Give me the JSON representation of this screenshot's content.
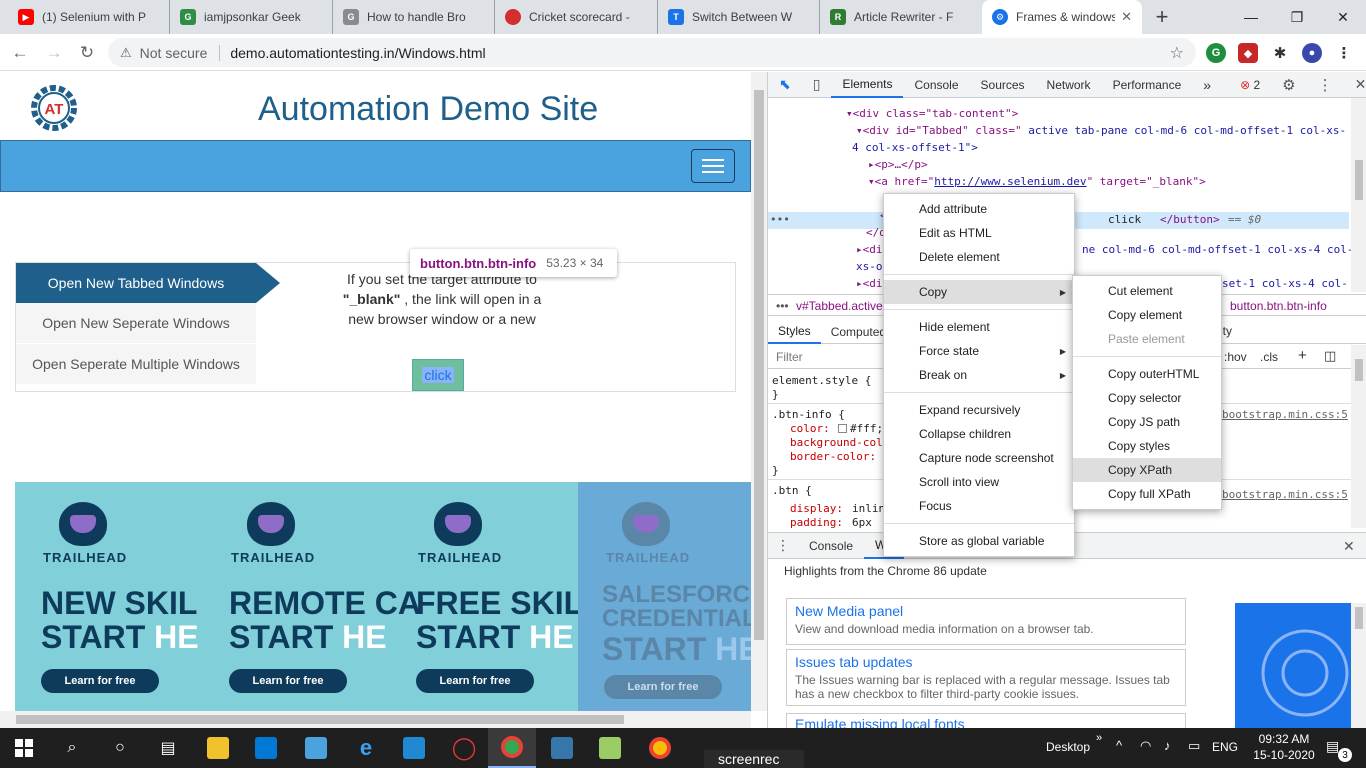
{
  "tabs": [
    {
      "title": "(1) Selenium with P",
      "icon": "youtube-icon",
      "color": "#ff0000"
    },
    {
      "title": "iamjpsonkar Geek",
      "icon": "geeksforgeeks-icon",
      "color": "#2f8d46"
    },
    {
      "title": "How to handle Bro",
      "icon": "gfg-icon",
      "color": "#8a8a8a"
    },
    {
      "title": "Cricket scorecard -",
      "icon": "cricket-icon",
      "color": "#d32f2f"
    },
    {
      "title": "Switch Between W",
      "icon": "tutorial-icon",
      "color": "#1a73e8"
    },
    {
      "title": "Article Rewriter - F",
      "icon": "rewriter-icon",
      "color": "#2e7d32"
    },
    {
      "title": "Frames & windows",
      "icon": "automation-icon",
      "color": "#1a73e8"
    }
  ],
  "window": {
    "new_tab": "+",
    "minimize": "—",
    "maximize": "❐",
    "close": "✕"
  },
  "address": {
    "security": "Not secure",
    "url": "demo.automationtesting.in/Windows.html"
  },
  "site": {
    "logo_text": "AT",
    "title": "Automation Demo Site",
    "vtabs": [
      "Open New Tabbed Windows",
      "Open New Seperate Windows",
      "Open Seperate Multiple Windows"
    ],
    "desc_prefix": "If you set the target attribute to",
    "desc_bold": "\"_blank\"",
    "desc_suffix": ", the link will open in a new browser window or a new",
    "button_label": "click",
    "tooltip_selector": "button.btn.btn-info",
    "tooltip_size": "53.23 × 34"
  },
  "banner": [
    {
      "brand": "TRAILHEAD",
      "l1": "NEW SKIL",
      "l2a": "START ",
      "l2b": "HE",
      "cta": "Learn for free"
    },
    {
      "brand": "TRAILHEAD",
      "l1": "REMOTE CA",
      "l2a": "START ",
      "l2b": "HE",
      "cta": "Learn for free"
    },
    {
      "brand": "TRAILHEAD",
      "l1": "FREE SKIL",
      "l2a": "START ",
      "l2b": "HE",
      "cta": "Learn for free"
    },
    {
      "brand": "TRAILHEAD",
      "l1": "SALESFORCE",
      "l1b": "CREDENTIAL",
      "l2a": "START ",
      "l2b": "HE",
      "cta": "Learn for free"
    }
  ],
  "devtools": {
    "tabs": [
      "Elements",
      "Console",
      "Sources",
      "Network",
      "Performance"
    ],
    "more": "»",
    "errors": "2",
    "dom": {
      "l0": "<div class=\"tab-content\">",
      "l1a": "<div id=\"Tabbed\" class=\"",
      "l1b": " active tab-pane col-md-6 col-md-offset-1 col-xs-",
      "l1c": "4 col-xs-offset-1\">",
      "l2": "<p>…</p>",
      "l3a": "<a href=\"",
      "l3link": "http://www.selenium.dev",
      "l3b": "\" target=\"_blank\">",
      "sel_dots": "•••",
      "sel_text": "click",
      "sel_close": "</button>",
      "sel_eq": "== $0",
      "l5": "<",
      "l6": "</d",
      "l7a": "<di",
      "l7b": "ne col-md-6 col-md-offset-1 col-xs-4 col-",
      "l8": "xs-o",
      "l9a": "<di",
      "l9b": "set-1 col-xs-4 col-"
    },
    "crumb_left": "v#Tabbed.active",
    "crumb_right": "button.btn.btn-info",
    "styles_tabs": [
      "Styles",
      "Computed"
    ],
    "styles_extra": "bility",
    "filter_placeholder": "Filter",
    "filter_hov": ":hov",
    "filter_cls": ".cls",
    "css": {
      "es": "element.style {",
      "es_close": "}",
      "r1": ".btn-info {",
      "r1_src": "bootstrap.min.css:5",
      "p1": "color:",
      "v1": "#fff;",
      "p2": "background-col",
      "p3": "border-color:",
      "r1_close": "}",
      "r2": ".btn {",
      "r2_src": "bootstrap.min.css:5",
      "p4": "display:",
      "v4": "inlin",
      "p5": "padding:",
      "v5": "6px"
    },
    "drawer_tabs": [
      "Console",
      "Wh"
    ],
    "drawer_heading": "Highlights from the Chrome 86 update",
    "news": [
      {
        "title": "New Media panel",
        "desc": "View and download media information on a browser tab."
      },
      {
        "title": "Issues tab updates",
        "desc": "The Issues warning bar is replaced with a regular message. Issues tab has a new checkbox to filter third-party cookie issues."
      },
      {
        "title": "Emulate missing local fonts",
        "desc": ""
      }
    ]
  },
  "context_menu": {
    "items": [
      "Add attribute",
      "Edit as HTML",
      "Delete element",
      "Copy",
      "Hide element",
      "Force state",
      "Break on",
      "Expand recursively",
      "Collapse children",
      "Capture node screenshot",
      "Scroll into view",
      "Focus",
      "Store as global variable"
    ],
    "arrow": "▶"
  },
  "copy_menu": {
    "items": [
      "Cut element",
      "Copy element",
      "Paste element",
      "Copy outerHTML",
      "Copy selector",
      "Copy JS path",
      "Copy styles",
      "Copy XPath",
      "Copy full XPath"
    ]
  },
  "taskbar": {
    "desktop": "Desktop",
    "lang": "ENG",
    "time": "09:32 AM",
    "date": "15-10-2020",
    "notif": "3",
    "screenrec": "screenrec"
  }
}
